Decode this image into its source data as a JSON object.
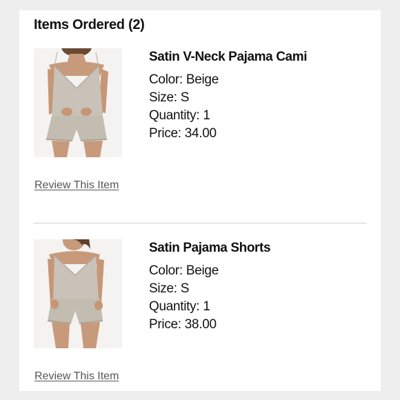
{
  "order": {
    "heading": "Items Ordered (2)",
    "items": [
      {
        "name": "Satin V-Neck Pajama Cami",
        "color": "Color: Beige",
        "size": "Size: S",
        "quantity": "Quantity: 1",
        "price": "Price: 34.00",
        "review_link": "Review This Item"
      },
      {
        "name": "Satin Pajama Shorts",
        "color": "Color: Beige",
        "size": "Size: S",
        "quantity": "Quantity: 1",
        "price": "Price: 38.00",
        "review_link": "Review This Item"
      }
    ]
  }
}
